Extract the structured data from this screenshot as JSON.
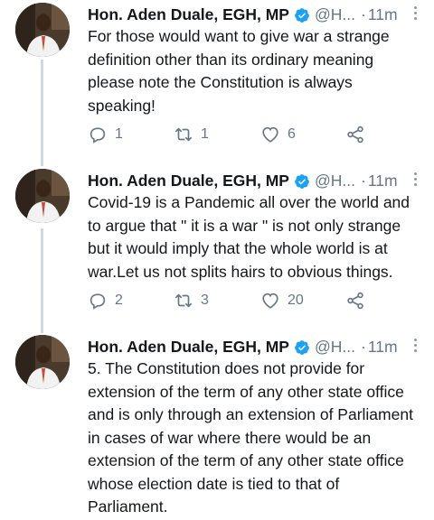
{
  "tweets": [
    {
      "name": "Hon. Aden Duale, EGH, MP",
      "handle": "@H...",
      "separator": "·",
      "time": "11m",
      "text": "For those would want to give war a strange\ndefinition other than its ordinary meaning\nplease note the Constitution is always\nspeaking!",
      "replies": "1",
      "retweets": "1",
      "likes": "6"
    },
    {
      "name": "Hon. Aden Duale, EGH, MP",
      "handle": "@H...",
      "separator": "·",
      "time": "11m",
      "text": "Covid-19 is a Pandemic all over the world and\nto argue that \" it is a war \" is not only strange\nbut it would imply that the whole world is at\nwar.Let us not splits hairs to obvious things.",
      "replies": "2",
      "retweets": "3",
      "likes": "20"
    },
    {
      "name": "Hon. Aden Duale, EGH, MP",
      "handle": "@H...",
      "separator": "·",
      "time": "11m",
      "text": "5. The Constitution does not provide for\nextension of the term of any other state office\nand is only through an extension of Parliament\nin cases of war where there would be an\nextension of the term of any other state office\nwhose election date is tied to that of\nParliament."
    }
  ],
  "icons": {
    "verified": "verified-badge-icon",
    "reply": "reply-icon",
    "retweet": "retweet-icon",
    "like": "heart-icon",
    "share": "share-icon",
    "more": "more-icon"
  },
  "colors": {
    "verified": "#1da1f2",
    "muted": "#657786",
    "thread_line": "#cfd9de"
  }
}
